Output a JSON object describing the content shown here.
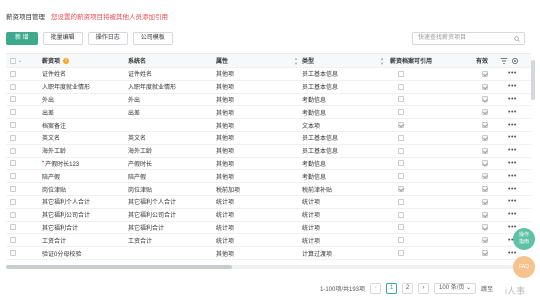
{
  "header": {
    "title": "薪资项目管理",
    "warning": "您设置的薪资项目将被其他人员添加引用"
  },
  "toolbar": {
    "new": "新 增",
    "batch_edit": "批量编辑",
    "log": "操作日志",
    "template": "公司模板"
  },
  "search": {
    "placeholder": "快速查找薪资项目"
  },
  "table": {
    "columns": [
      "薪资项",
      "系统名",
      "属性",
      "类型",
      "薪资档案可引用",
      "有效"
    ],
    "rows": [
      {
        "name": "证件姓名",
        "sys": "证件姓名",
        "attr": "其他项",
        "type": "员工基本信息",
        "file": false
      },
      {
        "name": "入职年度就业情形",
        "sys": "入职年度就业情形",
        "attr": "其他项",
        "type": "员工基本信息",
        "file": false
      },
      {
        "name": "外出",
        "sys": "外出",
        "attr": "其他项",
        "type": "考勤信息",
        "file": false
      },
      {
        "name": "出差",
        "sys": "出差",
        "attr": "其他项",
        "type": "考勤信息",
        "file": false
      },
      {
        "name": "档案备注",
        "sys": "",
        "attr": "其他项",
        "type": "文本项",
        "file": true
      },
      {
        "name": "英文名",
        "sys": "英文名",
        "attr": "其他项",
        "type": "员工基本信息",
        "file": false
      },
      {
        "name": "海外工龄",
        "sys": "海外工龄",
        "attr": "其他项",
        "type": "员工基本信息",
        "file": false
      },
      {
        "name": "产假时长123",
        "sys": "产假时长",
        "attr": "其他项",
        "type": "考勤信息",
        "file": false,
        "mark": "•"
      },
      {
        "name": "陪产假",
        "sys": "陪产假",
        "attr": "其他项",
        "type": "考勤信息",
        "file": false
      },
      {
        "name": "岗位津贴",
        "sys": "岗位津贴",
        "attr": "税前加项",
        "type": "税前津补贴",
        "file": true
      },
      {
        "name": "其它福利个人合计",
        "sys": "其它福利个人合计",
        "attr": "统计项",
        "type": "统计项",
        "file": false
      },
      {
        "name": "其它福利公司合计",
        "sys": "其它福利公司合计",
        "attr": "统计项",
        "type": "统计项",
        "file": false
      },
      {
        "name": "其它福利合计",
        "sys": "其它福利合计",
        "attr": "统计项",
        "type": "统计项",
        "file": false
      },
      {
        "name": "工资合计",
        "sys": "工资合计",
        "attr": "统计项",
        "type": "统计项",
        "file": false
      },
      {
        "name": "验证0分母校验",
        "sys": "",
        "attr": "其他项",
        "type": "计算过渡项",
        "file": false
      }
    ]
  },
  "pagination": {
    "summary": "1-100项/共193项",
    "pages": [
      "1",
      "2"
    ],
    "page_size": "100 条/页",
    "jump": "跳至"
  },
  "floating": {
    "help": [
      "操作",
      "指南"
    ],
    "faq": "FAQ"
  },
  "logo": "i人事"
}
